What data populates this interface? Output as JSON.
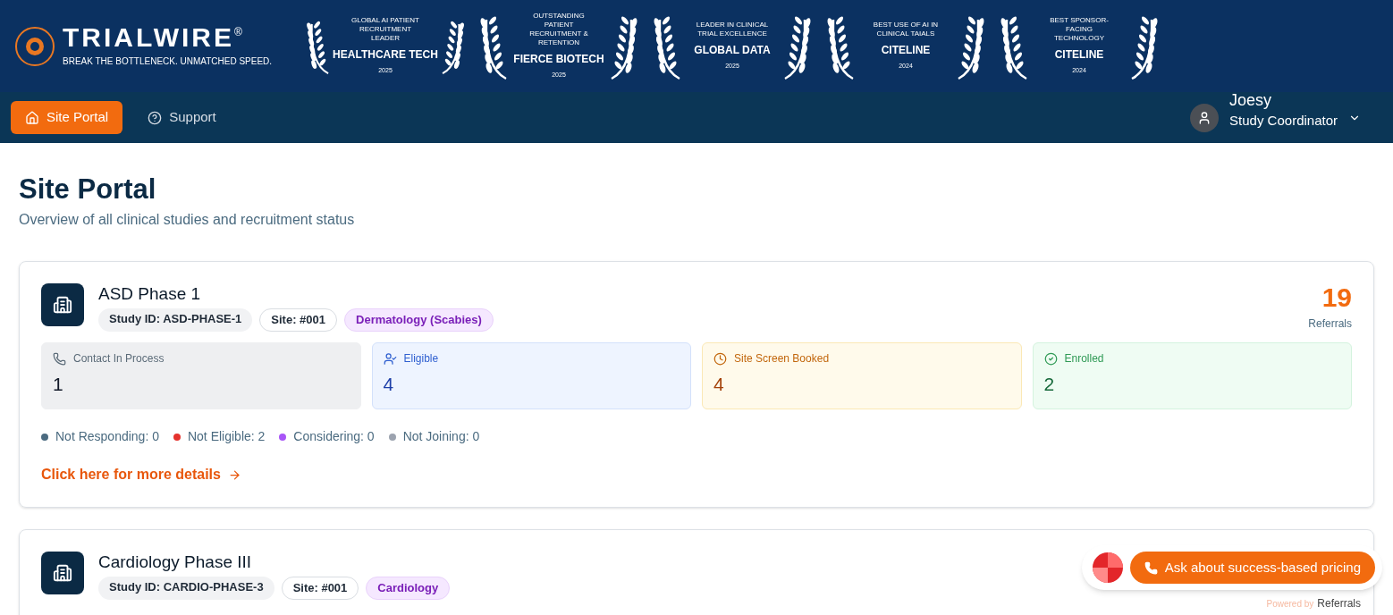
{
  "brand": {
    "name": "TRIALWIRE",
    "mark": "®",
    "tagline": "BREAK THE BOTTLENECK. UNMATCHED SPEED."
  },
  "awards": [
    {
      "title": "GLOBAL AI PATIENT RECRUITMENT LEADER",
      "source": "HEALTHCARE TECH",
      "year": "2025"
    },
    {
      "title": "OUTSTANDING PATIENT RECRUITMENT & RETENTION",
      "source": "FIERCE BIOTECH",
      "year": "2025"
    },
    {
      "title": "LEADER IN CLINICAL TRIAL EXCELLENCE",
      "source": "GLOBAL DATA",
      "year": "2025"
    },
    {
      "title": "BEST USE OF AI IN CLINICAL TAIALS",
      "source": "CITELINE",
      "year": "2024"
    },
    {
      "title": "BEST SPONSOR-FACING TECHNOLOGY",
      "source": "CITELINE",
      "year": "2024"
    }
  ],
  "nav": [
    {
      "label": "Site Portal",
      "kind": "home",
      "selected": true
    },
    {
      "label": "Support",
      "kind": "help",
      "selected": false
    }
  ],
  "user": {
    "name": "Joesy",
    "role": "Study Coordinator"
  },
  "page": {
    "title": "Site Portal",
    "subtitle": "Overview of all clinical studies and recruitment status"
  },
  "studies": [
    {
      "name": "ASD Phase 1",
      "study_id": "Study ID: ASD-PHASE-1",
      "site": "Site: #001",
      "area": "Dermatology (Scabies)",
      "referrals": "19",
      "referrals_label": "Referrals",
      "stats": [
        {
          "kind": "contact",
          "label": "Contact In Process",
          "value": "1"
        },
        {
          "kind": "eligible",
          "label": "Eligible",
          "value": "4"
        },
        {
          "kind": "booked",
          "label": "Site Screen Booked",
          "value": "4"
        },
        {
          "kind": "enrolled",
          "label": "Enrolled",
          "value": "2"
        }
      ],
      "outcomes": [
        {
          "label": "Not Responding: 0",
          "color": "#4b6b80"
        },
        {
          "label": "Not Eligible: 2",
          "color": "#e5322d"
        },
        {
          "label": "Considering: 0",
          "color": "#a855f7"
        },
        {
          "label": "Not Joining: 0",
          "color": "#9ca3af"
        }
      ],
      "link": "Click here for more details"
    },
    {
      "name": "Cardiology Phase III",
      "study_id": "Study ID: CARDIO-PHASE-3",
      "site": "Site: #001",
      "area": "Cardiology"
    }
  ],
  "widget": {
    "button": "Ask about success-based pricing",
    "powered_by": "Powered by",
    "brand": "Referrals"
  }
}
